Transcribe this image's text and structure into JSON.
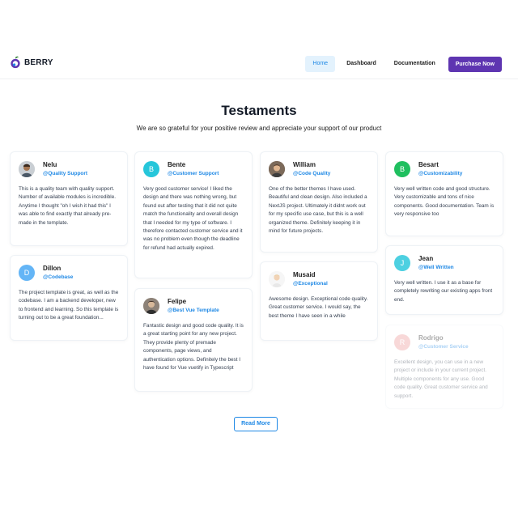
{
  "header": {
    "logo_text": "BERRY",
    "nav": {
      "home": "Home",
      "dashboard": "Dashboard",
      "documentation": "Documentation",
      "purchase": "Purchase Now"
    }
  },
  "section": {
    "title": "Testaments",
    "subtitle": "We are so grateful for your positive review and appreciate your support of our product"
  },
  "testimonials": [
    {
      "name": "Nelu",
      "handle": "@Quality Support",
      "text": "This is a quality team with quality support. Number of available modules is incredible. Anytime I thought \"oh I wish it had this\" I was able to find exactly that already pre-made in the template."
    },
    {
      "name": "Dillon",
      "initial": "D",
      "handle": "@Codebase",
      "text": "The project template is great, as well as the codebase. I am a backend developer, new to frontend and learning. So this template is turning out to be a great foundation..."
    },
    {
      "name": "Bente",
      "initial": "B",
      "handle": "@Customer Support",
      "text": "Very good customer service! I liked the design and there was nothing wrong, but found out after testing that it did not quite match the functionality and overall design that I needed for my type of software. I therefore contacted customer service and it was no problem even though the deadline for refund had actually expired."
    },
    {
      "name": "Felipe",
      "handle": "@Best Vue Template",
      "text": "Fantastic design and good code quality. It is a great starting point for any new project. They provide plenty of premade components, page views, and authentication options. Definitely the best I have found for Vue vuetify in Typescript"
    },
    {
      "name": "William",
      "handle": "@Code Quality",
      "text": "One of the better themes I have used. Beautiful and clean design. Also included a NextJS project. Ultimately it didnt work out for my specific use case, but this is a well organized theme. Definitely keeping it in mind for future projects."
    },
    {
      "name": "Musaid",
      "handle": "@Exceptional",
      "text": "Awesome design. Exceptional code quality. Great customer service. I would say, the best theme I have seen in a while"
    },
    {
      "name": "Besart",
      "initial": "B",
      "handle": "@Customizability",
      "text": "Very well written code and good structure. Very customizable and tons of nice components. Good documentation. Team is very responsive too"
    },
    {
      "name": "Jean",
      "initial": "J",
      "handle": "@Well Written",
      "text": "Very well written. I use it as a base for completely rewriting our existing apps front end."
    },
    {
      "name": "Rodrigo",
      "initial": "R",
      "handle": "@Customer Service",
      "text": "Excellent design, you can use in a new project or include in your current project. Multiple components for any use. Good code quality. Great customer service and support."
    }
  ],
  "read_more": "Read More",
  "colors": {
    "primary": "#1e88e5",
    "secondary": "#5e35b1",
    "avatar_dillon": "#64b5f6",
    "avatar_bente": "#26c6da",
    "avatar_besart": "#1fbf5f",
    "avatar_jean": "#4dd0e1",
    "avatar_rodrigo": "#ef9a9a"
  }
}
